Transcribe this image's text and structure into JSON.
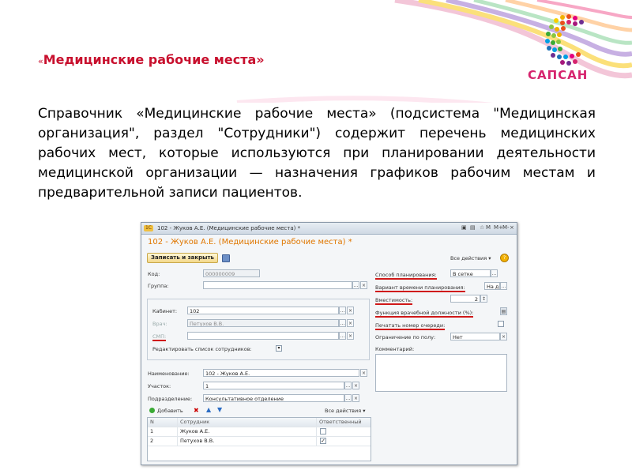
{
  "slide": {
    "title_open_quote": "«",
    "title": "Медицинские рабочие места»",
    "body": "Справочник «Медицинские рабочие места» (подсистема \"Медицинская организация\", раздел \"Сотрудники\") содержит перечень медицинских рабочих мест, которые используются при планировании деятельности медицинской организации — назначения графиков рабочим местам и предварительной записи пациентов.",
    "logo_text": "САПСАН"
  },
  "window": {
    "titlebar": "102 - Жуков А.Е. (Медицинские рабочие места) *",
    "titlebar_icon": "1С",
    "header": "102 - Жуков А.Е. (Медицинские рабочие места) *",
    "controls": [
      "M",
      "M+",
      "M-",
      "_",
      "□",
      "×"
    ],
    "save_close": "Записать и закрыть",
    "all_actions": "Все действия ▾",
    "help": "?",
    "left": {
      "code_label": "Код:",
      "code_value": "000000009",
      "group_label": "Группа:",
      "group_value": "",
      "cabinet_label": "Кабинет:",
      "cabinet_value": "102",
      "doctor_label": "Врач:",
      "doctor_value": "Петухов В.В.",
      "smp_label": "СМП:",
      "smp_value": "",
      "edit_staff_label": "Редактировать список сотрудников:",
      "name_label": "Наименование:",
      "name_value": "102 - Жуков А.Е.",
      "site_label": "Участок:",
      "site_value": "1",
      "dept_label": "Подразделение:",
      "dept_value": "Консультативное отделение",
      "add_button": "Добавить",
      "all_actions": "Все действия ▾",
      "table": {
        "columns": [
          "N",
          "Сотрудник",
          "Ответственный"
        ],
        "rows": [
          {
            "n": "1",
            "employee": "Жуков А.Е.",
            "responsible": false
          },
          {
            "n": "2",
            "employee": "Петухов В.В.",
            "responsible": true
          }
        ]
      }
    },
    "right": {
      "plan_method_label": "Способ планирования:",
      "plan_method_value": "В сетке",
      "time_variant_label": "Вариант времени планирования:",
      "time_variant_value": "На д",
      "capacity_label": "Вместимость:",
      "capacity_value": "2",
      "position_label": "Функция врачебной должности (%):",
      "print_queue_label": "Печатать номер очереди:",
      "gender_label": "Ограничение по полу:",
      "gender_value": "Нет",
      "comment_label": "Комментарий:"
    }
  },
  "colors": {
    "title_red": "#c8102e",
    "header_orange": "#e07700",
    "underline_red": "#d01818"
  }
}
